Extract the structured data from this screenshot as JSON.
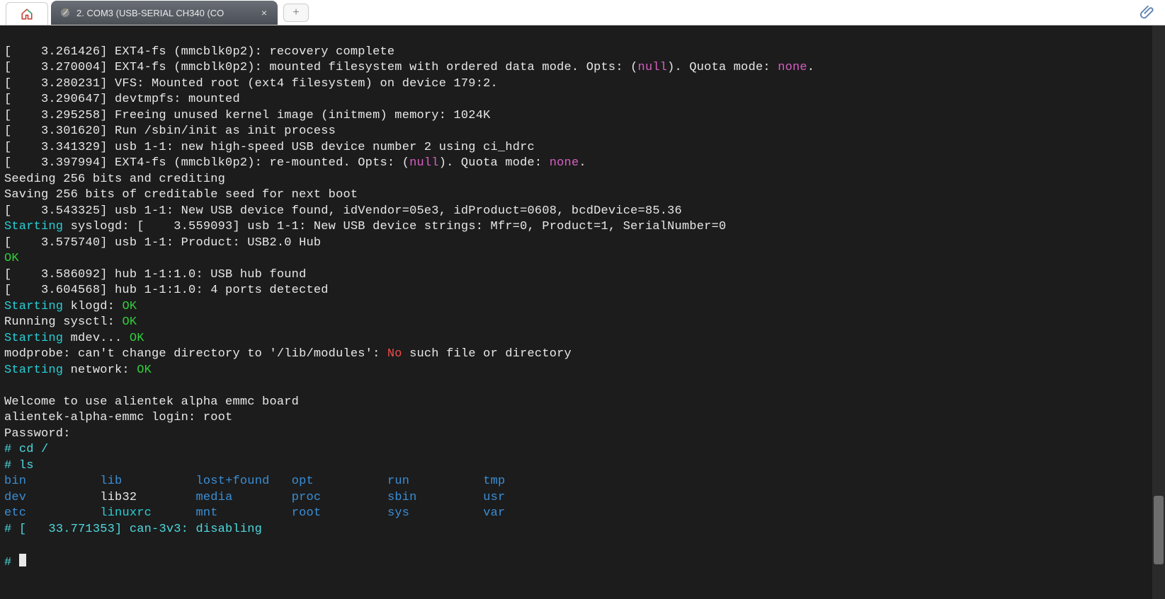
{
  "tabs": {
    "active_title": "2. COM3  (USB-SERIAL CH340 (CO",
    "close_glyph": "×",
    "new_glyph": "+"
  },
  "scrollbar": {
    "thumb_top_pct": 82,
    "thumb_height_pct": 12
  },
  "term": {
    "l01_a": "[    3.261426] EXT4-fs (mmcblk0p2): recovery complete",
    "l02_a": "[    3.270004] EXT4-fs (mmcblk0p2): mounted filesystem with ordered data mode. Opts: (",
    "l02_b": "null",
    "l02_c": "). Quota mode: ",
    "l02_d": "none",
    "l02_e": ".",
    "l03_a": "[    3.280231] VFS: Mounted root (ext4 filesystem) on device 179:2.",
    "l04_a": "[    3.290647] devtmpfs: mounted",
    "l05_a": "[    3.295258] Freeing unused kernel image (initmem) memory: 1024K",
    "l06_a": "[    3.301620] Run /sbin/init as init process",
    "l07_a": "[    3.341329] usb 1-1: new high-speed USB device number 2 using ci_hdrc",
    "l08_a": "[    3.397994] EXT4-fs (mmcblk0p2): re-mounted. Opts: (",
    "l08_b": "null",
    "l08_c": "). Quota mode: ",
    "l08_d": "none",
    "l08_e": ".",
    "l09_a": "Seeding 256 bits and crediting",
    "l10_a": "Saving 256 bits of creditable seed for next boot",
    "l11_a": "[    3.543325] usb 1-1: New USB device found, idVendor=05e3, idProduct=0608, bcdDevice=85.36",
    "l12_a": "Starting ",
    "l12_b": "syslogd: [    3.559093] usb 1-1: New USB device strings: Mfr=0, Product=1, SerialNumber=0",
    "l13_a": "[    3.575740] usb 1-1: Product: USB2.0 Hub",
    "l14_a": "OK",
    "l15_a": "[    3.586092] hub 1-1:1.0: USB hub found",
    "l16_a": "[    3.604568] hub 1-1:1.0: 4 ports detected",
    "l17_a": "Starting ",
    "l17_b": "klogd: ",
    "l17_c": "OK",
    "l18_a": "Running sysctl: ",
    "l18_b": "OK",
    "l19_a": "Starting ",
    "l19_b": "mdev... ",
    "l19_c": "OK",
    "l20_a": "modprobe: can't change directory to '/lib/modules': ",
    "l20_b": "No",
    "l20_c": " such file or directory",
    "l21_a": "Starting ",
    "l21_b": "network: ",
    "l21_c": "OK",
    "l22_blank": "",
    "l23_a": "Welcome to use alientek alpha emmc board",
    "l24_a": "alientek-alpha-emmc login: root",
    "l25_a": "Password:",
    "l26_a": "# ",
    "l26_b": "cd /",
    "l27_a": "# ",
    "l27_b": "ls",
    "ls_row1_c1": "bin",
    "ls_row1_c2": "lib",
    "ls_row1_c3": "lost+found",
    "ls_row1_c4": "opt",
    "ls_row1_c5": "run",
    "ls_row1_c6": "tmp",
    "ls_row2_c1": "dev",
    "ls_row2_c2": "lib32",
    "ls_row2_c3": "media",
    "ls_row2_c4": "proc",
    "ls_row2_c5": "sbin",
    "ls_row2_c6": "usr",
    "ls_row3_c1": "etc",
    "ls_row3_c2": "linuxrc",
    "ls_row3_c3": "mnt",
    "ls_row3_c4": "root",
    "ls_row3_c5": "sys",
    "ls_row3_c6": "var",
    "l31_a": "# ",
    "l31_b": "[   33.771353] can-3v3: disabling",
    "l32_blank": "",
    "l33_a": "# "
  },
  "colors": {
    "bg": "#1c1c1c",
    "fg": "#e8e8e8",
    "green": "#2fcf3a",
    "cyan": "#28d0d6",
    "blue": "#3a8ed6",
    "magenta": "#d65fc2",
    "red": "#ef4b4b"
  }
}
